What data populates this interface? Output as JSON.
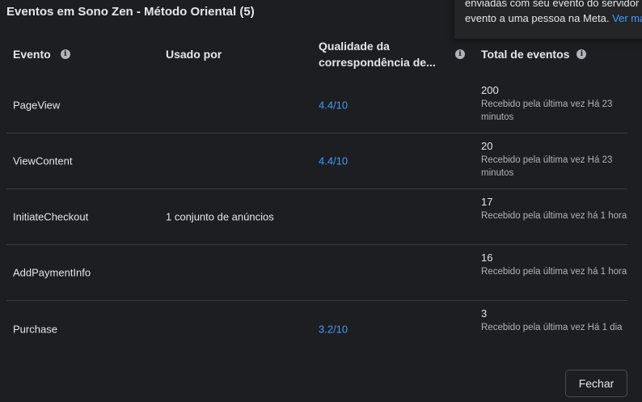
{
  "header": {
    "title": "Eventos em Sono Zen - Método Oriental (5)"
  },
  "tooltip": {
    "line1": "enviadas com seu evento do servidor",
    "line2": "evento a uma pessoa na Meta.",
    "link": "Ver mais"
  },
  "columns": {
    "event": "Evento",
    "used_by": "Usado por",
    "quality_line1": "Qualidade da",
    "quality_line2": "correspondência de...",
    "total": "Total de eventos"
  },
  "rows": [
    {
      "event": "PageView",
      "used_by": "",
      "quality": "4.4/10",
      "count": "200",
      "received": "Recebido pela última vez Há 23 minutos"
    },
    {
      "event": "ViewContent",
      "used_by": "",
      "quality": "4.4/10",
      "count": "20",
      "received": "Recebido pela última vez Há 23 minutos"
    },
    {
      "event": "InitiateCheckout",
      "used_by": "1 conjunto de anúncios",
      "quality": "",
      "count": "17",
      "received": "Recebido pela última vez há 1 hora"
    },
    {
      "event": "AddPaymentInfo",
      "used_by": "",
      "quality": "",
      "count": "16",
      "received": "Recebido pela última vez há 1 hora"
    },
    {
      "event": "Purchase",
      "used_by": "",
      "quality": "3.2/10",
      "count": "3",
      "received": "Recebido pela última vez Há 1 dia"
    }
  ],
  "footer": {
    "close_label": "Fechar"
  },
  "colors": {
    "background": "#1c1e21",
    "link": "#4599ff",
    "divider": "#3a3b3c"
  }
}
